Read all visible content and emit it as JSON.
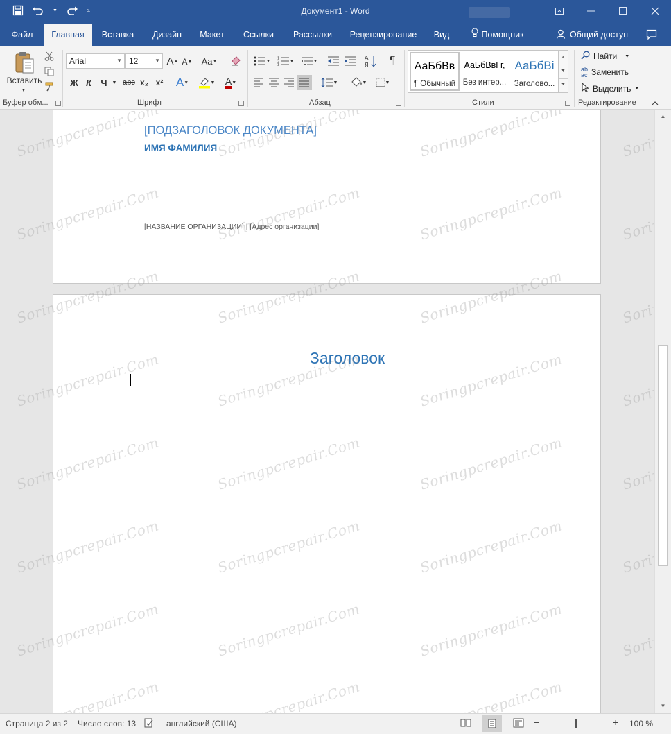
{
  "titlebar": {
    "title": "Документ1 - Word",
    "bg_color": "#2b579a"
  },
  "tabs": [
    {
      "label": "Файл",
      "active": false
    },
    {
      "label": "Главная",
      "active": true
    },
    {
      "label": "Вставка",
      "active": false
    },
    {
      "label": "Дизайн",
      "active": false
    },
    {
      "label": "Макет",
      "active": false
    },
    {
      "label": "Ссылки",
      "active": false
    },
    {
      "label": "Рассылки",
      "active": false
    },
    {
      "label": "Рецензирование",
      "active": false
    },
    {
      "label": "Вид",
      "active": false
    }
  ],
  "tell_me": "Помощник",
  "share": "Общий доступ",
  "ribbon": {
    "clipboard": {
      "paste_label": "Вставить",
      "group_label": "Буфер обм..."
    },
    "font": {
      "font_name": "Arial",
      "font_size": "12",
      "group_label": "Шрифт",
      "bold": "Ж",
      "italic": "К",
      "underline": "Ч",
      "strike": "abc",
      "subscript": "x₂",
      "superscript": "x²",
      "grow": "A",
      "shrink": "A",
      "case": "Aa",
      "effects": "A",
      "font_color": "A"
    },
    "paragraph": {
      "group_label": "Абзац",
      "pilcrow": "¶"
    },
    "styles": {
      "group_label": "Стили",
      "items": [
        {
          "preview": "АаБбВв",
          "name": "¶ Обычный"
        },
        {
          "preview": "АаБбВвГг,",
          "name": "Без интер..."
        },
        {
          "preview": "АаБбВі",
          "name": "Заголово..."
        }
      ]
    },
    "editing": {
      "group_label": "Редактирование",
      "find": "Найти",
      "replace": "Заменить",
      "select": "Выделить"
    }
  },
  "document": {
    "page1": {
      "subtitle": "[ПОДЗАГОЛОВОК ДОКУМЕНТА]",
      "author": "ИМЯ ФАМИЛИЯ",
      "org": "[НАЗВАНИЕ ОРГАНИЗАЦИИ] | [Адрес организации]"
    },
    "page2": {
      "heading": "Заголовок"
    }
  },
  "watermark": "Soringpcrepair.Com",
  "status": {
    "page": "Страница 2 из 2",
    "words": "Число слов: 13",
    "language": "английский (США)",
    "zoom": "100 %"
  }
}
